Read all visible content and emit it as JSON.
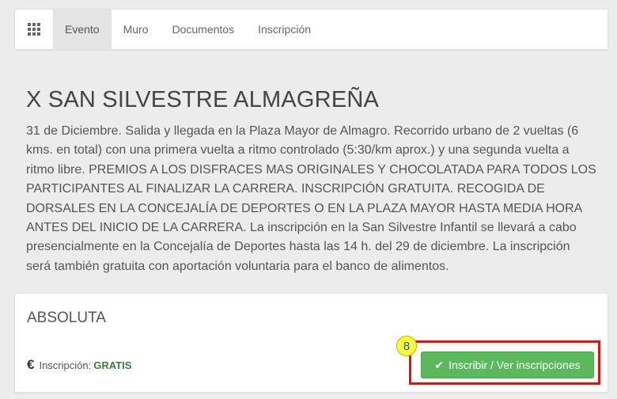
{
  "nav": {
    "menu_icon": "grid-icon",
    "tabs": [
      {
        "label": "Evento",
        "active": true
      },
      {
        "label": "Muro"
      },
      {
        "label": "Documentos"
      },
      {
        "label": "Inscripción"
      }
    ]
  },
  "event": {
    "title": "X SAN SILVESTRE ALMAGREÑA",
    "description": "31 de Diciembre. Salida y llegada en la Plaza Mayor de Almagro. Recorrido urbano de 2 vueltas (6 kms. en total) con una primera vuelta a ritmo controlado (5:30/km aprox.) y una segunda vuelta a ritmo libre. PREMIOS A LOS DISFRACES MAS ORIGINALES Y CHOCOLATADA PARA TODOS LOS PARTICIPANTES AL FINALIZAR LA CARRERA. INSCRIPCIÓN GRATUITA. RECOGIDA DE DORSALES EN LA CONCEJALÍA DE DEPORTES O EN LA PLAZA MAYOR HASTA MEDIA HORA ANTES DEL INICIO DE LA CARRERA. La inscripción en la San Silvestre Infantil se llevará a cabo presencialmente en la Concejalía de Deportes hasta las 14 h. del 29 de diciembre. La inscripción será también gratuita con aportación voluntaria para el banco de alimentos."
  },
  "category": {
    "name": "ABSOLUTA",
    "currency_symbol": "€",
    "price_label": "Inscripción:",
    "price_value": "GRATIS",
    "button_label": "Inscribir / Ver inscripciones",
    "button_icon": "check-icon"
  },
  "annotation": {
    "badge_number": "8"
  },
  "colors": {
    "button_green": "#5cb85c",
    "price_green": "#3d7a3d",
    "highlight_red": "#d81515",
    "badge_yellow": "#ffff3b"
  }
}
